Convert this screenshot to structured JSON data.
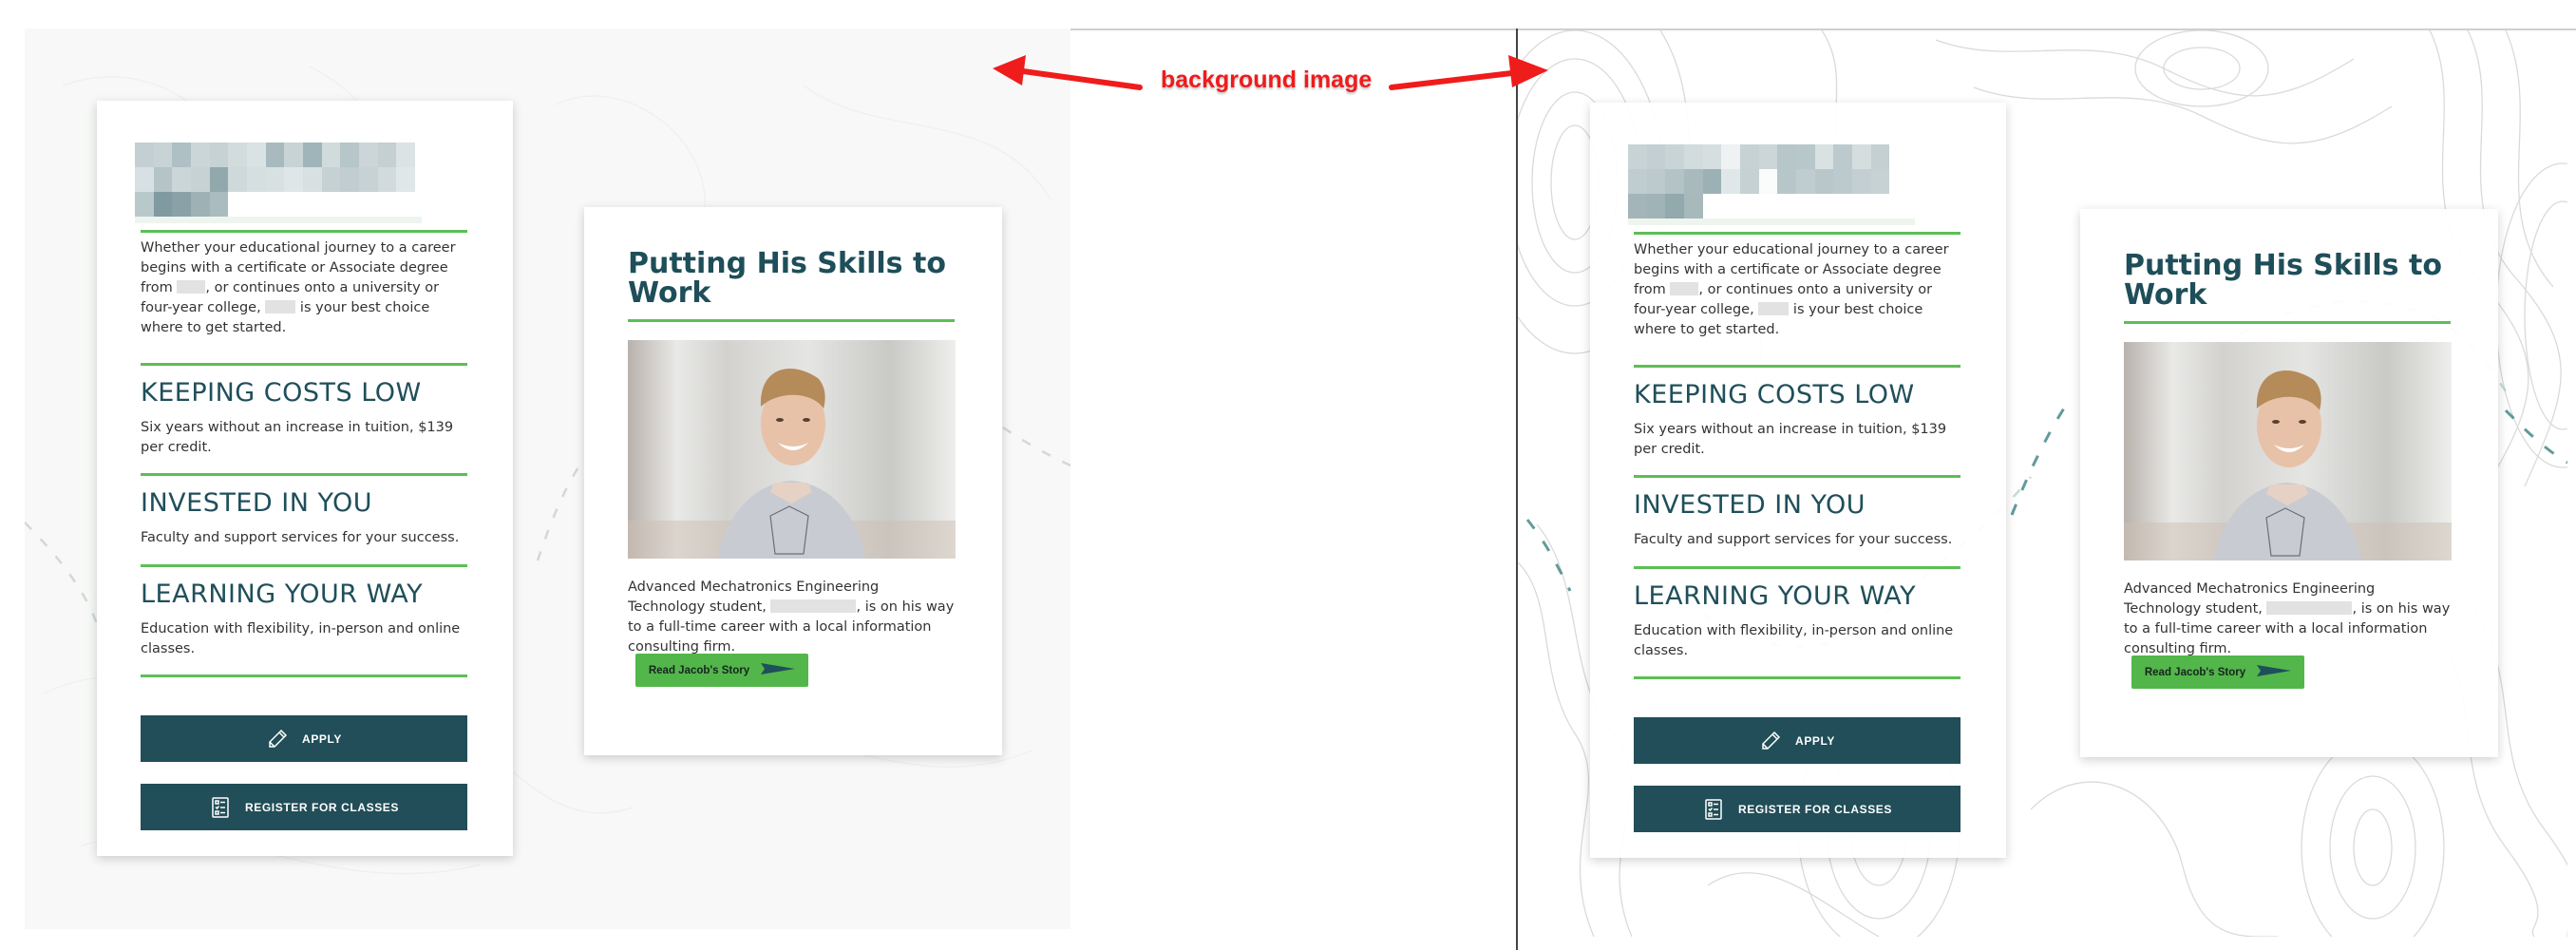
{
  "annotation": {
    "label": "background image",
    "color": "#ef1c1c"
  },
  "theme": {
    "accent_green": "#5cbf55",
    "button_green": "#52b64a",
    "dark_teal": "#214e58",
    "heading_teal": "#1f4f5a"
  },
  "panels": [
    {
      "id": "without-background",
      "info_card": {
        "logo": "redacted-logo",
        "intro_parts": [
          "Whether your educational journey to a career begins with a certificate or Associate degree from ",
          ", or continues onto a university or four-year college, ",
          " is your best choice where to get started."
        ],
        "sections": [
          {
            "title": "KEEPING COSTS LOW",
            "text": "Six years without an increase in tuition, $139 per credit."
          },
          {
            "title": "INVESTED IN YOU",
            "text": "Faculty and support services for your success."
          },
          {
            "title": "LEARNING YOUR WAY",
            "text": "Education with flexibility, in-person and online classes."
          }
        ],
        "buttons": [
          {
            "label": "APPLY",
            "icon": "pencil-icon"
          },
          {
            "label": "REGISTER FOR CLASSES",
            "icon": "checklist-icon"
          }
        ]
      },
      "story_card": {
        "title": "Putting His Skills to Work",
        "photo": "smiling-student-portrait",
        "text_parts": [
          "Advanced Mechatronics Engineering Technology student, ",
          ", is on his way to a full-time career with a local information consulting firm."
        ],
        "button_label": "Read Jacob's Story",
        "button_icon": "arrow-right-icon"
      }
    },
    {
      "id": "with-background",
      "info_card": {
        "logo": "redacted-logo",
        "intro_parts": [
          "Whether your educational journey to a career begins with a certificate or Associate degree from ",
          ", or continues onto a university or four-year college, ",
          " is your best choice where to get started."
        ],
        "sections": [
          {
            "title": "KEEPING COSTS LOW",
            "text": "Six years without an increase in tuition, $139 per credit."
          },
          {
            "title": "INVESTED IN YOU",
            "text": "Faculty and support services for your success."
          },
          {
            "title": "LEARNING YOUR WAY",
            "text": "Education with flexibility, in-person and online classes."
          }
        ],
        "buttons": [
          {
            "label": "APPLY",
            "icon": "pencil-icon"
          },
          {
            "label": "REGISTER FOR CLASSES",
            "icon": "checklist-icon"
          }
        ]
      },
      "story_card": {
        "title": "Putting His Skills to Work",
        "photo": "smiling-student-portrait",
        "text_parts": [
          "Advanced Mechatronics Engineering Technology student, ",
          ", is on his way to a full-time career with a local information consulting firm."
        ],
        "button_label": "Read Jacob's Story",
        "button_icon": "arrow-right-icon"
      }
    }
  ]
}
